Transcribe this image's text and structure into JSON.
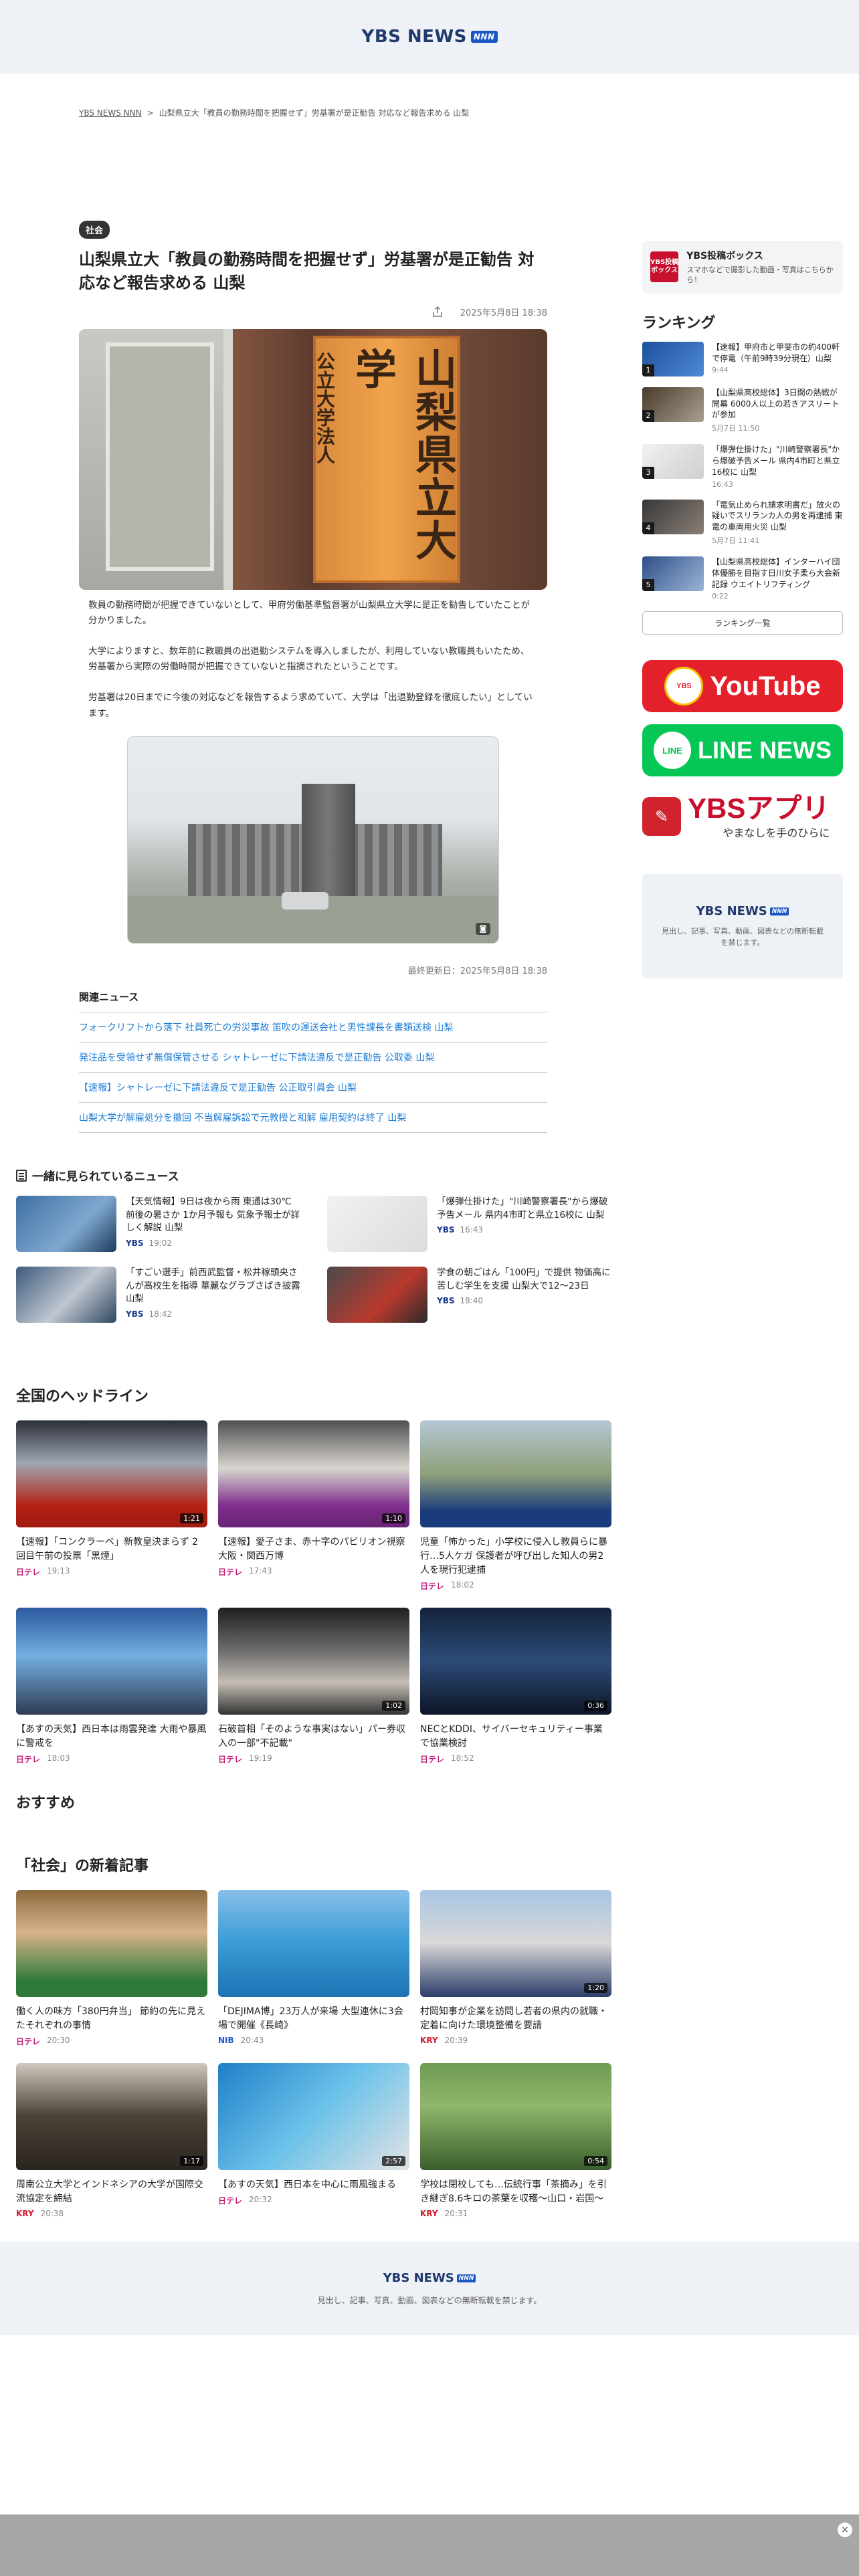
{
  "header": {
    "logo_text": "YBS NEWS",
    "logo_badge": "NNN"
  },
  "breadcrumb": {
    "home": "YBS NEWS NNN",
    "separator": ">",
    "current": "山梨県立大「教員の勤務時間を把握せず」労基署が是正勧告 対応など報告求める 山梨"
  },
  "article": {
    "category": "社会",
    "title": "山梨県立大「教員の勤務時間を把握せず」労基署が是正勧告 対応など報告求める 山梨",
    "date": "2025年5月8日 18:38",
    "sign_small": "公立大学法人",
    "sign_big": "山梨県立大学",
    "paragraphs": [
      "教員の勤務時間が把握できていないとして、甲府労働基準監督署が山梨県立大学に是正を勧告していたことが分かりました。",
      "大学によりますと、数年前に教職員の出退勤システムを導入しましたが、利用していない教職員もいたため、労基署から実際の労働時間が把握できていないと指摘されたということです。",
      "労基署は20日までに今後の対応などを報告するよう求めていて、大学は「出退勤登録を徹底したい」としています。"
    ],
    "updated": "最終更新日：2025年5月8日 18:38",
    "related_title": "関連ニュース",
    "related": [
      "フォークリフトから落下 社員死亡の労災事故 笛吹の運送会社と男性課長を書類送検 山梨",
      "発注品を受領せず無償保管させる シャトレーゼに下請法違反で是正勧告 公取委 山梨",
      "【速報】シャトレーゼに下請法違反で是正勧告 公正取引員会 山梨",
      "山梨大学が解雇処分を撤回 不当解雇訴訟で元教授と和解 雇用契約は終了 山梨"
    ]
  },
  "together": {
    "title": "一緒に見られているニュース",
    "items": [
      {
        "title": "【天気情報】9日は夜から雨 東通は30℃前後の暑さか 1か月予報も 気象予報士が詳しく解説 山梨",
        "source": "YBS",
        "time": "19:02",
        "duration": ""
      },
      {
        "title": "「爆弾仕掛けた」\"川崎警察署長\"から爆破予告メール 県内4市町と県立16校に 山梨",
        "source": "YBS",
        "time": "16:43",
        "duration": ""
      },
      {
        "title": "「すごい選手」前西武監督・松井稼頭央さんが高校生を指導 華麗なグラブさばき披露 山梨",
        "source": "YBS",
        "time": "18:42",
        "duration": ""
      },
      {
        "title": "学食の朝ごはん「100円」で提供 物価高に苦しむ学生を支援 山梨大で12～23日",
        "source": "YBS",
        "time": "18:40",
        "duration": ""
      }
    ]
  },
  "headlines": {
    "title": "全国のヘッドライン",
    "items": [
      {
        "title": "【速報】「コンクラーベ」新教皇決まらず 2回目午前の投票「黒煙」",
        "source": "日テレ",
        "time": "19:13",
        "duration": "1:21"
      },
      {
        "title": "【速報】愛子さま、赤十字のパビリオン視察 大阪・関西万博",
        "source": "日テレ",
        "time": "17:43",
        "duration": "1:10"
      },
      {
        "title": "児童「怖かった」小学校に侵入し教員らに暴行…5人ケガ 保護者が呼び出した知人の男2人を現行犯逮捕",
        "source": "日テレ",
        "time": "18:02",
        "duration": ""
      },
      {
        "title": "【あすの天気】西日本は雨雲発達 大雨や暴風に警戒を",
        "source": "日テレ",
        "time": "18:03",
        "duration": ""
      },
      {
        "title": "石破首相「そのような事実はない」パー券収入の一部\"不記載\"",
        "source": "日テレ",
        "time": "19:19",
        "duration": "1:02"
      },
      {
        "title": "NECとKDDI、サイバーセキュリティー事業で協業検討",
        "source": "日テレ",
        "time": "18:52",
        "duration": "0:36"
      }
    ]
  },
  "recommend_title": "おすすめ",
  "new_articles": {
    "title": "「社会」の新着記事",
    "items": [
      {
        "title": "働く人の味方「380円弁当」 節約の先に見えたそれぞれの事情",
        "source": "日テレ",
        "time": "20:30",
        "duration": ""
      },
      {
        "title": "「DEJIMA博」23万人が来場 大型連休に3会場で開催《長崎》",
        "source": "NIB",
        "time": "20:43",
        "duration": ""
      },
      {
        "title": "村岡知事が企業を訪問し若者の県内の就職・定着に向けた環境整備を要請",
        "source": "KRY",
        "time": "20:39",
        "duration": "1:20"
      },
      {
        "title": "周南公立大学とインドネシアの大学が国際交流協定を締結",
        "source": "KRY",
        "time": "20:38",
        "duration": "1:17"
      },
      {
        "title": "【あすの天気】西日本を中心に雨風強まる",
        "source": "日テレ",
        "time": "20:32",
        "duration": "2:57"
      },
      {
        "title": "学校は閉校しても…伝統行事「茶摘み」を引き継ぎ8.6キロの茶葉を収穫～山口・岩国～",
        "source": "KRY",
        "time": "20:31",
        "duration": "0:54"
      }
    ]
  },
  "sidebar": {
    "post_icon_text": "YBS投稿ボックス",
    "post_title": "YBS投稿ボックス",
    "post_sub": "スマホなどで撮影した動画・写真はこちらから！",
    "ranking_title": "ランキング",
    "ranking": [
      {
        "title": "【速報】甲府市と甲斐市の約400軒で停電（午前9時39分現在）山梨",
        "date": "9:44"
      },
      {
        "title": "【山梨県高校総体】3日間の熱戦が開幕 6000人以上の若きアスリートが参加",
        "date": "5月7日 11:50"
      },
      {
        "title": "「爆弾仕掛けた」\"川崎警察署長\"から爆破予告メール 県内4市町と県立16校に 山梨",
        "date": "16:43"
      },
      {
        "title": "「電気止められ請求明書だ」放火の疑いでスリランカ人の男を再逮捕 東電の車両用火災 山梨",
        "date": "5月7日 11:41"
      },
      {
        "title": "【山梨県高校総体】インターハイ団体優勝を目指す日川女子柔ら大会新記録 ウエイトリフティング",
        "date": "0:22"
      }
    ],
    "ranking_more": "ランキング一覧",
    "youtube_badge": "YBS",
    "youtube_text": "YouTube",
    "line_badge": "LINE",
    "line_text": "LINE NEWS",
    "app_text": "YBSアプリ",
    "app_sub": "やまなしを手のひらに",
    "notice_logo": "YBS NEWS",
    "notice_badge": "NNN",
    "notice_text": "見出し、記事、写真、動画、図表などの無断転載を禁じます。"
  },
  "footer": {
    "logo": "YBS NEWS",
    "badge": "NNN",
    "text": "見出し、記事、写真、動画、図表などの無断転載を禁じます。"
  },
  "bottom_bar": {
    "close_symbol": "×"
  }
}
